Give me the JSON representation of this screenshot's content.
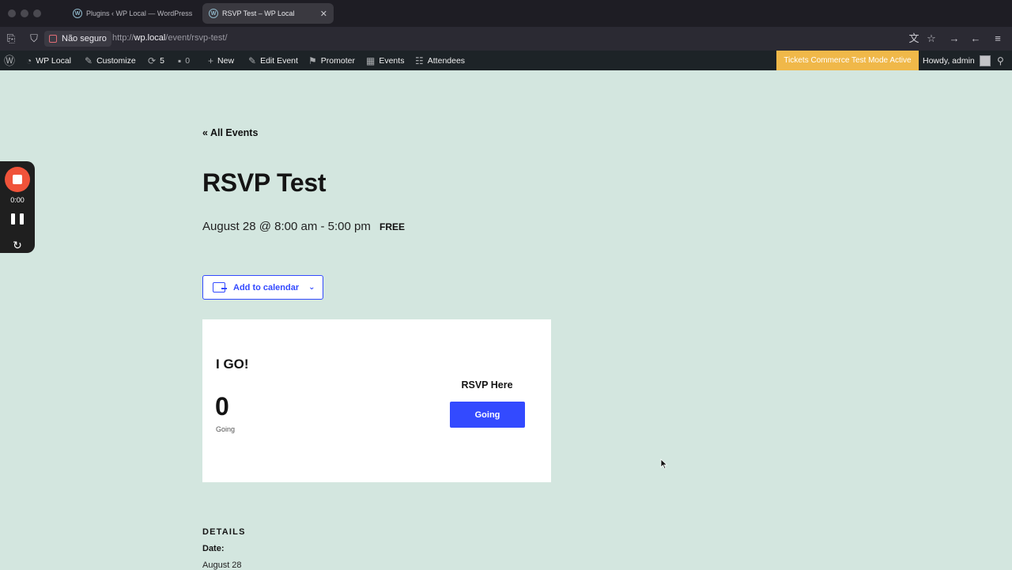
{
  "browser": {
    "tabs": [
      {
        "title": "Plugins ‹ WP Local — WordPress"
      },
      {
        "title": "RSVP Test – WP Local"
      }
    ],
    "security_label": "Não seguro",
    "url_prefix": "http://",
    "url_host": "wp.local",
    "url_path": "/event/rsvp-test/"
  },
  "adminbar": {
    "site_name": "WP Local",
    "customize": "Customize",
    "updates_count": "5",
    "comments_count": "0",
    "new": "New",
    "edit_event": "Edit Event",
    "promoter": "Promoter",
    "events": "Events",
    "attendees": "Attendees",
    "test_mode": "Tickets Commerce Test Mode Active",
    "howdy": "Howdy, admin"
  },
  "recorder": {
    "time": "0:00"
  },
  "event": {
    "back_link": "« All Events",
    "title": "RSVP Test",
    "when": "August 28 @ 8:00 am - 5:00 pm",
    "cost": "FREE",
    "add_to_calendar": "Add to calendar"
  },
  "rsvp": {
    "heading": "I GO!",
    "count": "0",
    "count_label": "Going",
    "cta_heading": "RSVP Here",
    "button": "Going"
  },
  "details": {
    "heading": "DETAILS",
    "date_label": "Date:",
    "date_value": "August 28"
  }
}
